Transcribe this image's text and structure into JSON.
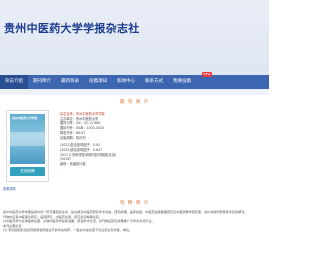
{
  "site": {
    "title": "贵州中医药大学学报杂志社"
  },
  "nav": {
    "items": [
      "杂志介绍",
      "期刊简介",
      "最新目录",
      "投稿须知",
      "新闻中心",
      "联系方式",
      "我要投稿"
    ],
    "badge": "NEW"
  },
  "sections": {
    "journal_info": "期 刊 简 介",
    "description": "刊 物 简 介"
  },
  "cover": {
    "small_title": "贵州中医药大学学报",
    "button": "在线投稿"
  },
  "info_rows": [
    "杂志名称：贵州中医药大学学报",
    "主办单位：贵州中医药大学",
    "国内刊号：CN：52-1176/R",
    "国际刊号：ISSN：1000-3424",
    "邮发代号：66-97",
    "出版周期：双月刊",
    "(2022)复合影响因子：0.92",
    "(2022)综合影响因子：0.647",
    "2017 Z 所科学技术期刊剪刊数据(北京)",
    "(2016)",
    "级别：省级统计源"
  ],
  "small_link": "查看详情",
  "description": [
    "贵州中医药大学学报是贵州省一所高等院校主办，旨在报道中医药研究学术动态、研究成果、临床经验、中医药文献整理研究及中医药教学研究等，贵州省期刊质量考评优秀期刊。",
    "刊物中设有中医理论研究、临床研究、中医药文献、研究生园地等栏目。",
    "以中医药学为主体面向全国，反映中医药学最新进展，促进学术交流，办刊物设研究成果推广与学术交流平台。",
    "本刊主要栏目：",
    "(1) 带标题和栏目名称使用说明性文字的中文简称，一般在中文标题下标注英文及作者、单位。"
  ]
}
